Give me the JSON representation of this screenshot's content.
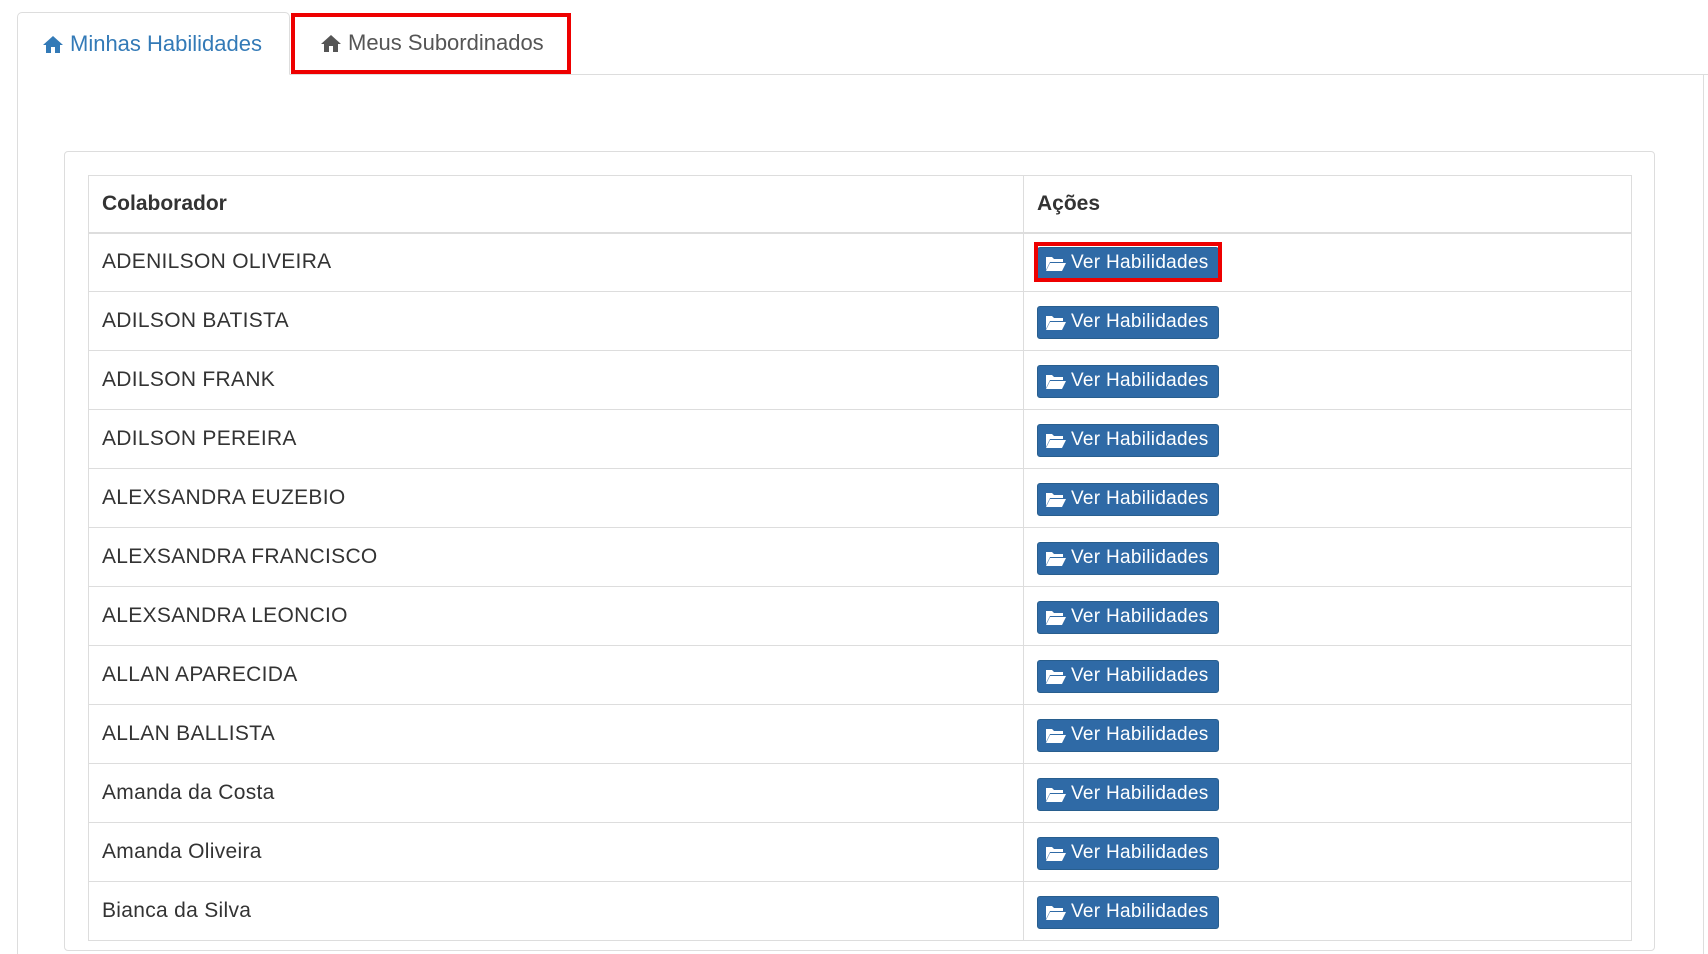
{
  "tabs": [
    {
      "label": "Minhas Habilidades",
      "icon": "home-icon",
      "active": true
    },
    {
      "label": "Meus Subordinados",
      "icon": "home-icon",
      "active": false
    }
  ],
  "table": {
    "headers": [
      "Colaborador",
      "Ações"
    ],
    "action_label": "Ver Habilidades",
    "action_icon": "folder-open-icon",
    "rows": [
      "ADENILSON OLIVEIRA",
      "ADILSON BATISTA",
      "ADILSON FRANK",
      "ADILSON PEREIRA",
      "ALEXSANDRA EUZEBIO",
      "ALEXSANDRA FRANCISCO",
      "ALEXSANDRA LEONCIO",
      "ALLAN APARECIDA",
      "ALLAN BALLISTA",
      "Amanda da Costa",
      "Amanda Oliveira",
      "Bianca da Silva"
    ]
  },
  "colors": {
    "link": "#337ab7",
    "button": "#2f6aa6",
    "highlight": "#ee0000",
    "border": "#dddddd"
  }
}
